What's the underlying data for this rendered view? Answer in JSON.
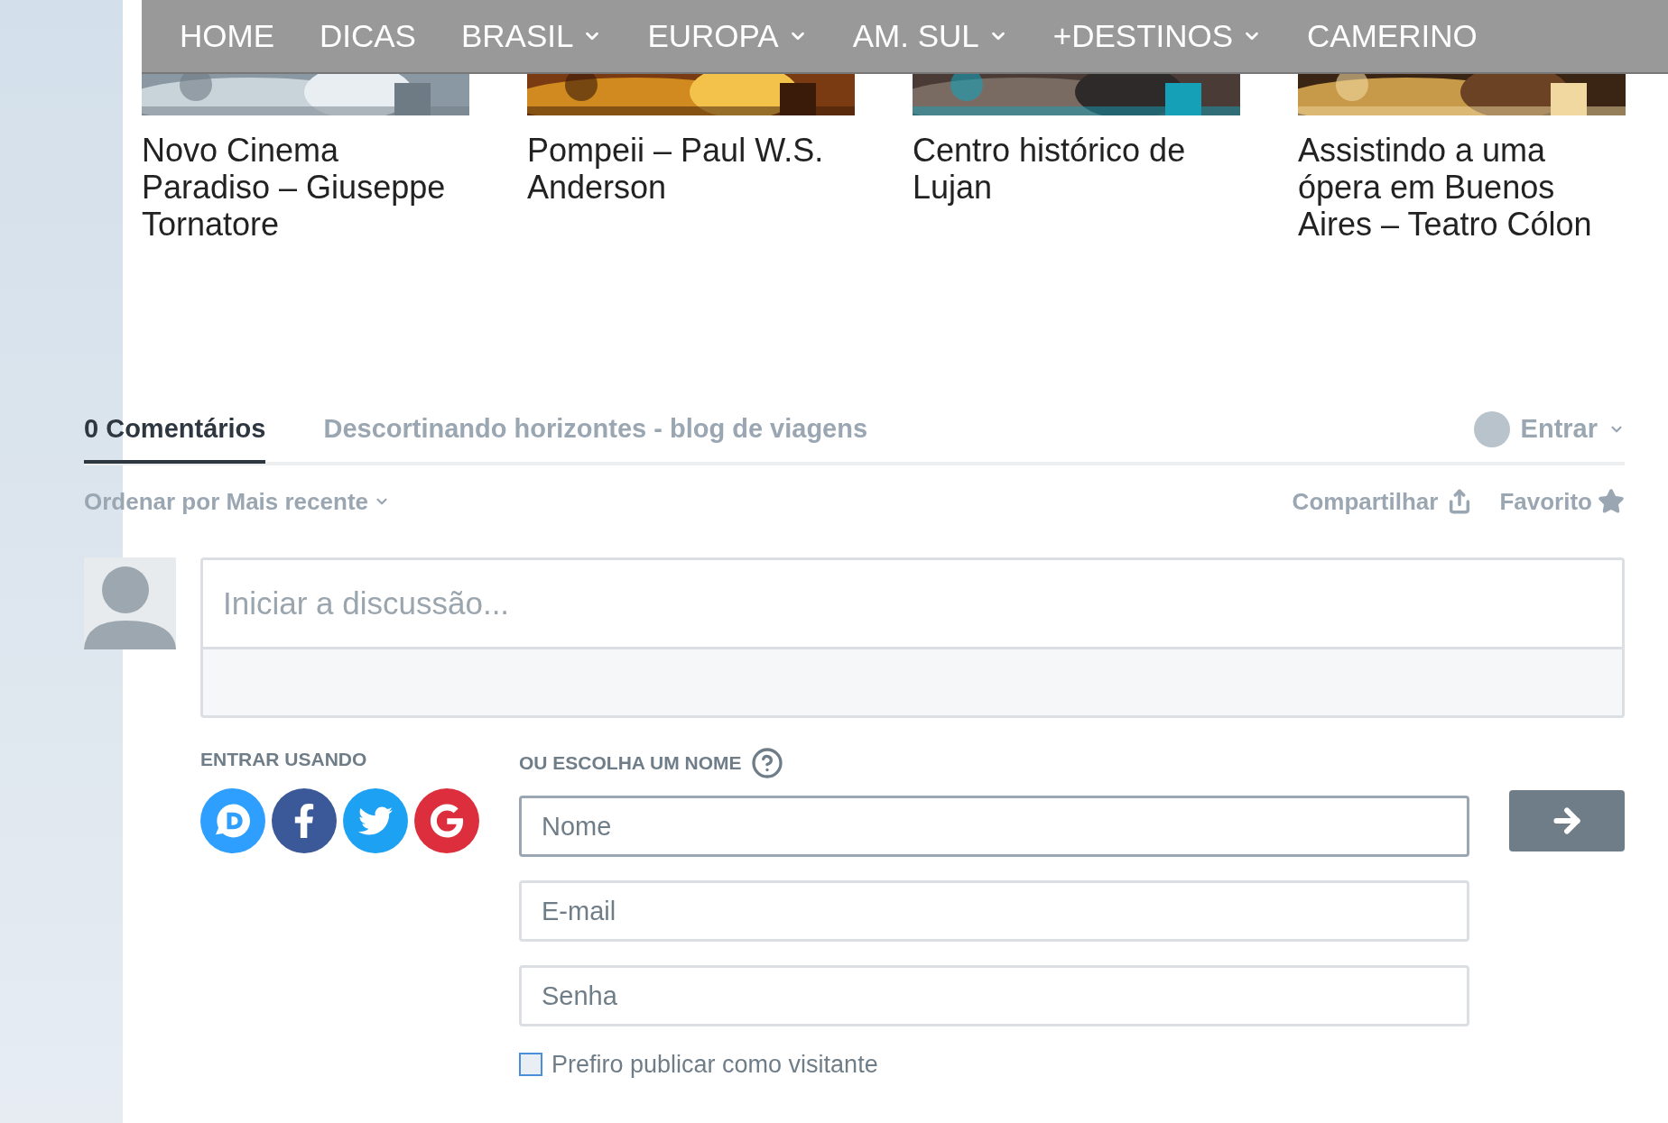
{
  "nav": {
    "items": [
      {
        "label": "HOME",
        "kind": "link"
      },
      {
        "label": "DICAS",
        "kind": "link"
      },
      {
        "label": "BRASIL",
        "kind": "dropdown"
      },
      {
        "label": "EUROPA",
        "kind": "dropdown"
      },
      {
        "label": "AM. SUL",
        "kind": "dropdown"
      },
      {
        "label": "+DESTINOS",
        "kind": "dropdown"
      },
      {
        "label": "CAMERINO",
        "kind": "link"
      }
    ]
  },
  "related_posts": [
    {
      "title": "Novo Cinema Paradiso – Giuseppe Tornatore",
      "kind": "picture"
    },
    {
      "title": "Pompeii – Paul W.S. Anderson",
      "kind": "picture"
    },
    {
      "title": "Centro histórico de Lujan",
      "kind": "picture"
    },
    {
      "title": "Assistindo a uma ópera em Buenos Aires – Teatro Cólon",
      "kind": "picture"
    }
  ],
  "comments": {
    "tabs": [
      {
        "label": "0 Comentários",
        "selected": true
      },
      {
        "label": "Descortinando horizontes - blog de viagens",
        "selected": false
      }
    ],
    "login": "Entrar",
    "sort": "Ordenar por Mais recente",
    "share": "Compartilhar",
    "favorite": "Favorito",
    "composer": {
      "placeholder": "Iniciar a discussão..."
    },
    "login_with_label": "ENTRAR USANDO",
    "name_label": "OU ESCOLHA UM NOME",
    "fields": [
      {
        "placeholder": "Nome",
        "focused": true
      },
      {
        "placeholder": "E-mail",
        "focused": false
      },
      {
        "placeholder": "Senha",
        "focused": false
      }
    ],
    "guest": {
      "label": "Prefiro publicar como visitante",
      "checked": false
    }
  }
}
